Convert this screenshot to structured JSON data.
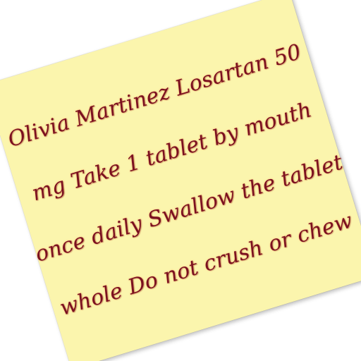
{
  "note": {
    "background_color": "#fbf5ad",
    "ink_color": "#7a1020",
    "lines": [
      "Olivia Martinez Losartan 50",
      "mg Take 1 tablet by mouth",
      "once daily Swallow the tablet",
      "whole Do not crush or chew"
    ]
  }
}
